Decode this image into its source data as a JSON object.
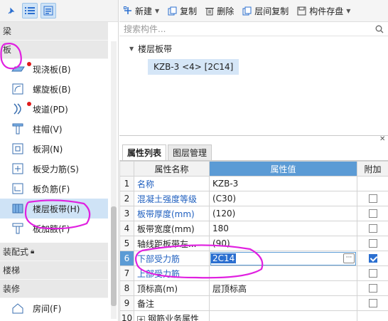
{
  "sidebar": {
    "categories": {
      "beam": "梁",
      "slab": "板",
      "prefab": "装配式",
      "stairs": "楼梯",
      "decor": "装修"
    },
    "items": [
      {
        "label": "现浇板(B)",
        "icon": "cast-slab-icon",
        "dot": true
      },
      {
        "label": "螺旋板(B)",
        "icon": "spiral-slab-icon",
        "dot": false
      },
      {
        "label": "坡道(PD)",
        "icon": "ramp-icon",
        "dot": true
      },
      {
        "label": "柱帽(V)",
        "icon": "column-cap-icon",
        "dot": false
      },
      {
        "label": "板洞(N)",
        "icon": "slab-hole-icon",
        "dot": false
      },
      {
        "label": "板受力筋(S)",
        "icon": "slab-rebar-icon",
        "dot": false
      },
      {
        "label": "板负筋(F)",
        "icon": "negative-rebar-icon",
        "dot": false
      },
      {
        "label": "楼层板带(H)",
        "icon": "slab-strip-icon",
        "dot": false,
        "selected": true
      },
      {
        "label": "板加腋(F)",
        "icon": "slab-haunch-icon",
        "dot": false
      }
    ],
    "decor_items": [
      {
        "label": "房间(F)",
        "icon": "room-icon"
      }
    ]
  },
  "toolbar": {
    "new": "新建",
    "copy": "复制",
    "delete": "删除",
    "floor_copy": "层间复制",
    "save_component": "构件存盘"
  },
  "search": {
    "placeholder": "搜索构件..."
  },
  "tree": {
    "group": "楼层板带",
    "leaf": "KZB-3 <4> [2C14]"
  },
  "prop_panel": {
    "tabs": [
      "属性列表",
      "图层管理"
    ],
    "headers": {
      "name": "属性名称",
      "value": "属性值",
      "extra": "附加"
    },
    "rows": [
      {
        "n": "1",
        "name": "名称",
        "value": "KZB-3",
        "blue": true,
        "cb": null
      },
      {
        "n": "2",
        "name": "混凝土强度等级",
        "value": "(C30)",
        "blue": true,
        "cb": false
      },
      {
        "n": "3",
        "name": "板带厚度(mm)",
        "value": "(120)",
        "blue": true,
        "cb": false
      },
      {
        "n": "4",
        "name": "板带宽度(mm)",
        "value": "180",
        "blue": false,
        "cb": false
      },
      {
        "n": "5",
        "name": "轴线距板带左...",
        "value": "(90)",
        "blue": false,
        "cb": false
      },
      {
        "n": "6",
        "name": "下部受力筋",
        "value": "2C14",
        "blue": true,
        "cb": true,
        "edit": true
      },
      {
        "n": "7",
        "name": "上部受力筋",
        "value": "",
        "blue": true,
        "cb": false
      },
      {
        "n": "8",
        "name": "顶标高(m)",
        "value": "层顶标高",
        "blue": false,
        "cb": false
      },
      {
        "n": "9",
        "name": "备注",
        "value": "",
        "blue": false,
        "cb": false
      },
      {
        "n": "10",
        "name": "钢筋业务属性",
        "value": "",
        "blue": false,
        "cb": null,
        "expand": true
      }
    ]
  },
  "colors": {
    "accent": "#5b9bd5",
    "selection": "#cfe3f6",
    "annotation": "#e020e0",
    "label_blue": "#1f5fbf"
  }
}
